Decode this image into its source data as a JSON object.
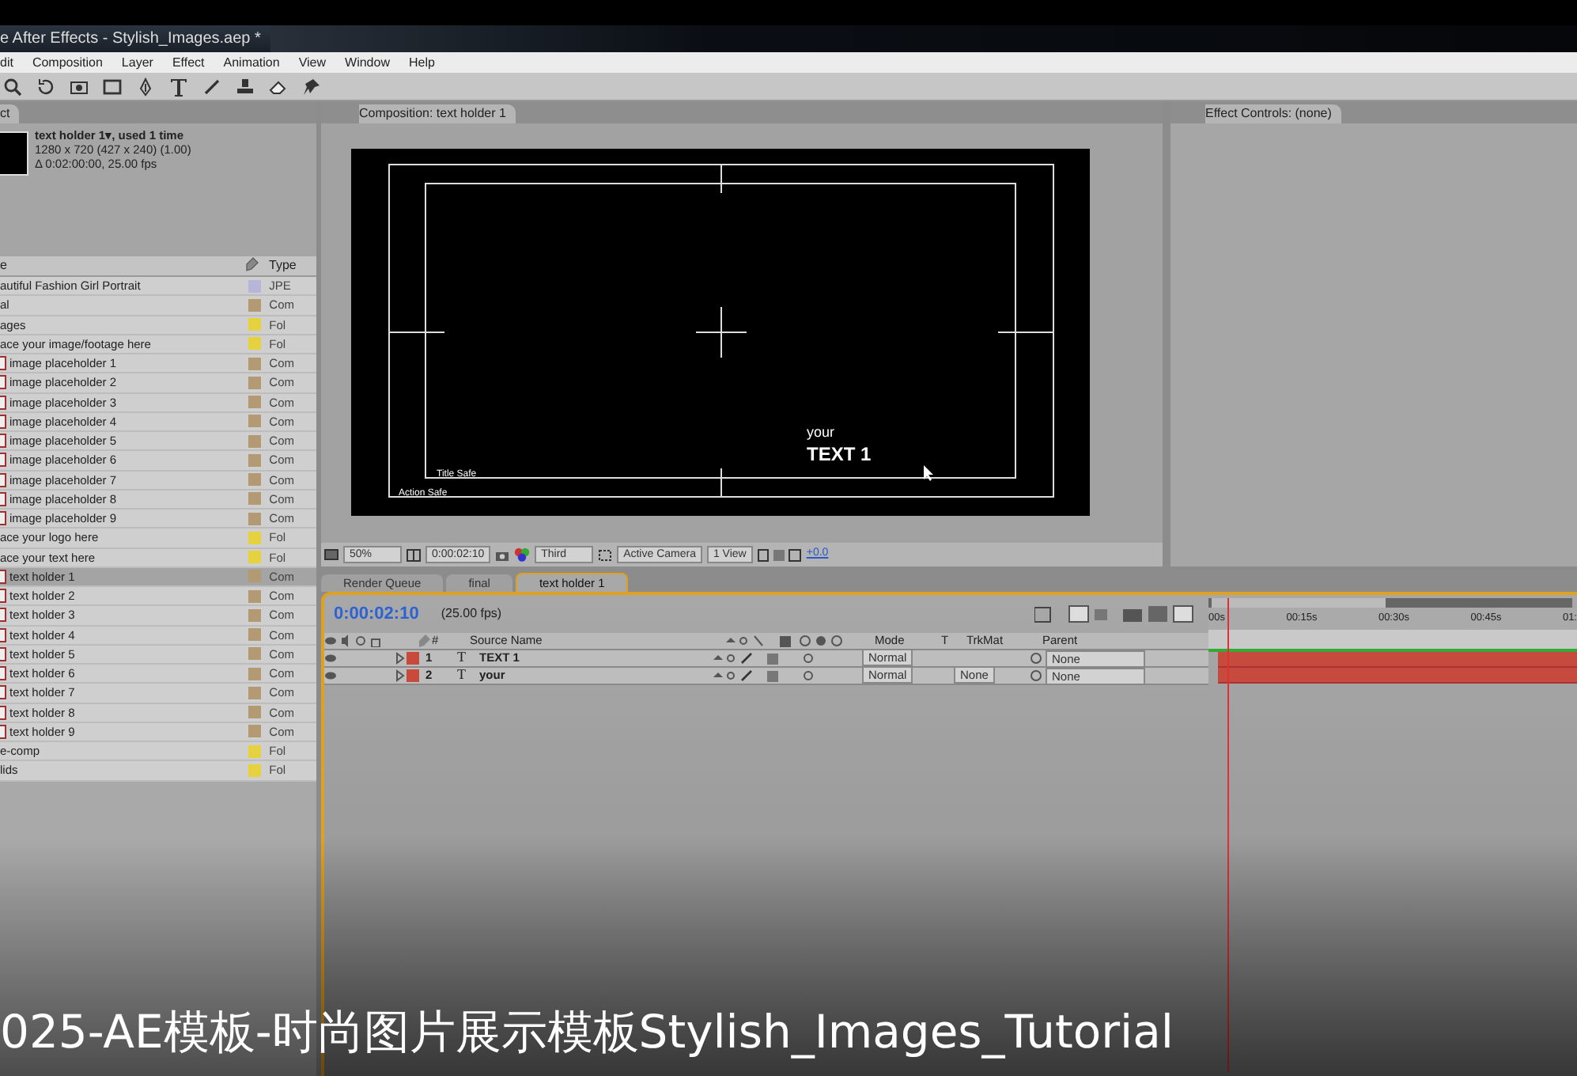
{
  "window": {
    "title": "e After Effects - Stylish_Images.aep *"
  },
  "menu": [
    "dit",
    "Composition",
    "Layer",
    "Effect",
    "Animation",
    "View",
    "Window",
    "Help"
  ],
  "project_panel": {
    "tab": "ct",
    "info": {
      "name": "text holder 1▾, used 1 time",
      "size": "1280 x 720  (427 x 240) (1.00)",
      "duration": "Δ 0:02:00:00, 25.00 fps"
    },
    "columns": {
      "name": "e",
      "type": "Type"
    },
    "items": [
      {
        "name": "autiful Fashion Girl Portrait",
        "type": "JPE",
        "color": "#b8b6d8",
        "icon": false,
        "selected": false
      },
      {
        "name": "al",
        "type": "Com",
        "color": "#b49a72",
        "icon": false,
        "selected": false
      },
      {
        "name": "ages",
        "type": "Fol",
        "color": "#e6d13e",
        "icon": false,
        "selected": false
      },
      {
        "name": "ace your image/footage here",
        "type": "Fol",
        "color": "#e6d13e",
        "icon": false,
        "selected": false
      },
      {
        "name": "image placeholder 1",
        "type": "Com",
        "color": "#b49a72",
        "icon": true,
        "selected": false
      },
      {
        "name": "image placeholder 2",
        "type": "Com",
        "color": "#b49a72",
        "icon": true,
        "selected": false
      },
      {
        "name": "image placeholder 3",
        "type": "Com",
        "color": "#b49a72",
        "icon": true,
        "selected": false
      },
      {
        "name": "image placeholder 4",
        "type": "Com",
        "color": "#b49a72",
        "icon": true,
        "selected": false
      },
      {
        "name": "image placeholder 5",
        "type": "Com",
        "color": "#b49a72",
        "icon": true,
        "selected": false
      },
      {
        "name": "image placeholder 6",
        "type": "Com",
        "color": "#b49a72",
        "icon": true,
        "selected": false
      },
      {
        "name": "image placeholder 7",
        "type": "Com",
        "color": "#b49a72",
        "icon": true,
        "selected": false
      },
      {
        "name": "image placeholder 8",
        "type": "Com",
        "color": "#b49a72",
        "icon": true,
        "selected": false
      },
      {
        "name": "image placeholder 9",
        "type": "Com",
        "color": "#b49a72",
        "icon": true,
        "selected": false
      },
      {
        "name": "ace your logo here",
        "type": "Fol",
        "color": "#e6d13e",
        "icon": false,
        "selected": false
      },
      {
        "name": "ace your text here",
        "type": "Fol",
        "color": "#e6d13e",
        "icon": false,
        "selected": false
      },
      {
        "name": "text holder 1",
        "type": "Com",
        "color": "#b49a72",
        "icon": true,
        "selected": true
      },
      {
        "name": "text holder 2",
        "type": "Com",
        "color": "#b49a72",
        "icon": true,
        "selected": false
      },
      {
        "name": "text holder 3",
        "type": "Com",
        "color": "#b49a72",
        "icon": true,
        "selected": false
      },
      {
        "name": "text holder 4",
        "type": "Com",
        "color": "#b49a72",
        "icon": true,
        "selected": false
      },
      {
        "name": "text holder 5",
        "type": "Com",
        "color": "#b49a72",
        "icon": true,
        "selected": false
      },
      {
        "name": "text holder 6",
        "type": "Com",
        "color": "#b49a72",
        "icon": true,
        "selected": false
      },
      {
        "name": "text holder 7",
        "type": "Com",
        "color": "#b49a72",
        "icon": true,
        "selected": false
      },
      {
        "name": "text holder 8",
        "type": "Com",
        "color": "#b49a72",
        "icon": true,
        "selected": false
      },
      {
        "name": "text holder 9",
        "type": "Com",
        "color": "#b49a72",
        "icon": true,
        "selected": false
      },
      {
        "name": "e-comp",
        "type": "Fol",
        "color": "#e6d13e",
        "icon": false,
        "selected": false
      },
      {
        "name": "lids",
        "type": "Fol",
        "color": "#e6d13e",
        "icon": false,
        "selected": false
      }
    ]
  },
  "composition_panel": {
    "tab": "Composition: text holder 1",
    "viewer": {
      "small_text": "your",
      "big_text": "TEXT 1",
      "title_safe": "Title Safe",
      "action_safe": "Action Safe"
    },
    "footer": {
      "zoom": "50%",
      "time": "0:00:02:10",
      "resolution": "Third",
      "camera": "Active Camera",
      "views": "1 View",
      "exposure": "+0.0"
    }
  },
  "effect_panel": {
    "tab": "Effect Controls: (none)"
  },
  "timeline": {
    "tabs": [
      {
        "label": "Render Queue",
        "selected": false
      },
      {
        "label": "final",
        "selected": false
      },
      {
        "label": "text holder 1",
        "selected": true
      }
    ],
    "time": "0:00:02:10",
    "fps": "(25.00 fps)",
    "columns": {
      "number": "#",
      "source": "Source Name",
      "mode": "Mode",
      "t": "T",
      "trkmat": "TrkMat",
      "parent": "Parent"
    },
    "layers": [
      {
        "number": "1",
        "type_mark": "T",
        "name": "TEXT 1",
        "mode": "Normal",
        "parent": "None"
      },
      {
        "number": "2",
        "type_mark": "T",
        "name": "your",
        "mode": "Normal",
        "trkmat": "None",
        "parent": "None"
      }
    ],
    "ruler": [
      "00s",
      "00:15s",
      "00:30s",
      "00:45s",
      "01:"
    ]
  },
  "caption": "025-AE模板-时尚图片展示模板Stylish_Images_Tutorial"
}
